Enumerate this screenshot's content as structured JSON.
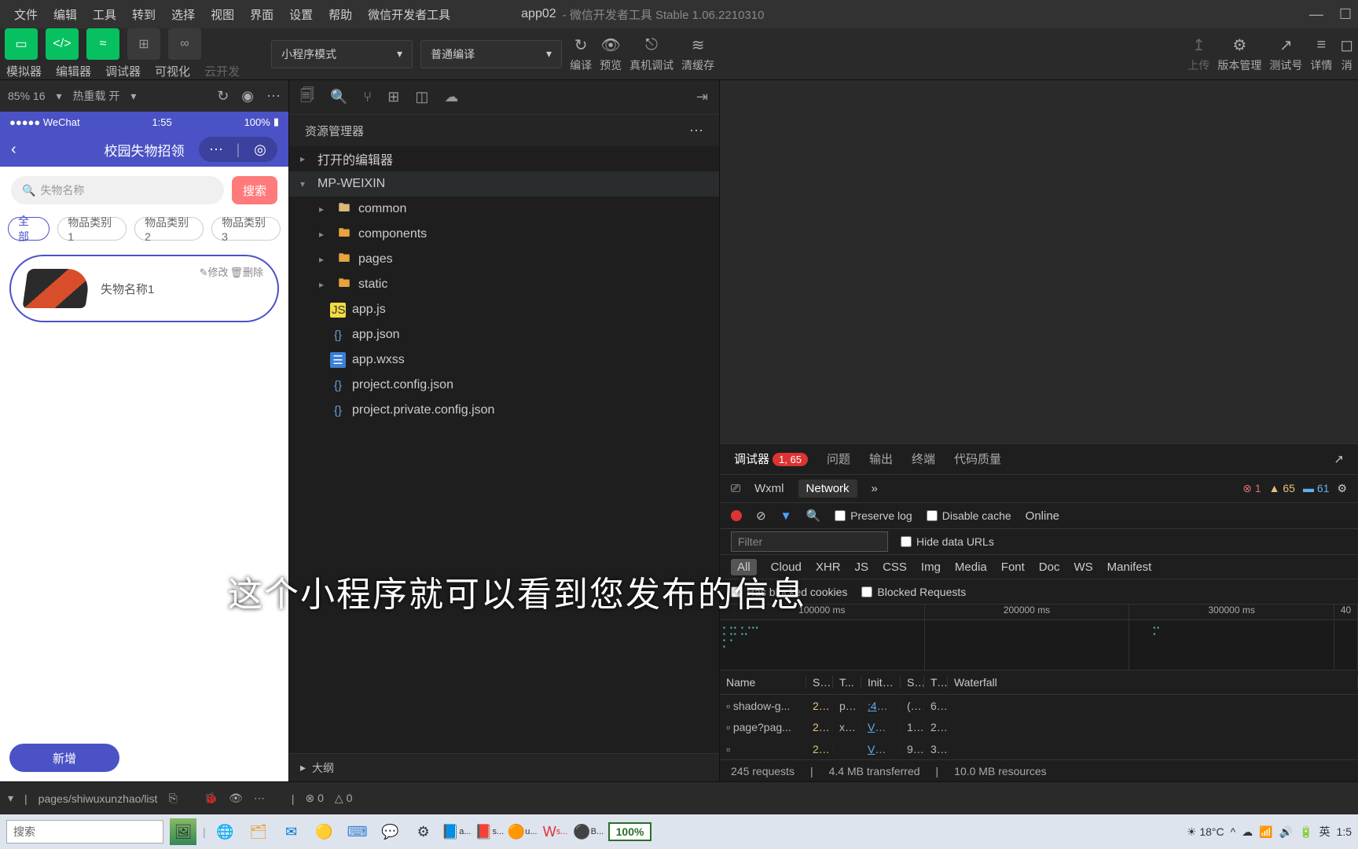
{
  "titlebar": {
    "menus": [
      "文件",
      "编辑",
      "工具",
      "转到",
      "选择",
      "视图",
      "界面",
      "设置",
      "帮助",
      "微信开发者工具"
    ],
    "app": "app02",
    "sub": " - 微信开发者工具 Stable 1.06.2210310"
  },
  "toolbar": {
    "labels": [
      "模拟器",
      "编辑器",
      "调试器",
      "可视化",
      "云开发"
    ],
    "select1": "小程序模式",
    "select2": "普通编译",
    "cols": [
      {
        "ic": "↻",
        "t": "编译"
      },
      {
        "ic": "👁",
        "t": "预览"
      },
      {
        "ic": "⎋",
        "t": "真机调试"
      },
      {
        "ic": "≋",
        "t": "清缓存"
      }
    ],
    "rcols": [
      {
        "ic": "↥",
        "t": "上传"
      },
      {
        "ic": "⚙",
        "t": "版本管理"
      },
      {
        "ic": "↗",
        "t": "测试号"
      },
      {
        "ic": "≡",
        "t": "详情"
      },
      {
        "ic": "◻",
        "t": "消"
      }
    ]
  },
  "sim": {
    "zoom": "85% 16",
    "hot": "热重载 开",
    "status": {
      "carrier": "●●●●● WeChat",
      "time": "1:55",
      "batt": "100%"
    },
    "nav": "校园失物招领",
    "search_ph": "失物名称",
    "search_btn": "搜索",
    "tabs": [
      "全部",
      "物品类别1",
      "物品类别2",
      "物品类别3"
    ],
    "card": {
      "title": "失物名称1",
      "edit": "✎修改",
      "del": "🗑删除"
    },
    "add": "新增"
  },
  "explorer": {
    "title": "资源管理器",
    "open": "打开的编辑器",
    "root": "MP-WEIXIN",
    "folders": [
      "common",
      "components",
      "pages",
      "static"
    ],
    "files": [
      "app.js",
      "app.json",
      "app.wxss",
      "project.config.json",
      "project.private.config.json"
    ],
    "outline": "大纲"
  },
  "devtools": {
    "tabs": [
      "调试器",
      "问题",
      "输出",
      "终端",
      "代码质量"
    ],
    "badge": "1, 65",
    "sub": [
      "Wxml",
      "Network"
    ],
    "err": "1",
    "warn": "65",
    "info": "61",
    "ctrl": {
      "preserve": "Preserve log",
      "disable": "Disable cache",
      "online": "Online"
    },
    "filter_ph": "Filter",
    "hide": "Hide data URLs",
    "types": [
      "All",
      "Cloud",
      "XHR",
      "JS",
      "CSS",
      "Img",
      "Media",
      "Font",
      "Doc",
      "WS",
      "Manifest"
    ],
    "blk1": "Has blocked cookies",
    "blk2": "Blocked Requests",
    "times": [
      "100000 ms",
      "200000 ms",
      "300000 ms",
      "40"
    ],
    "cols": [
      "Name",
      "S...",
      "T...",
      "Initia...",
      "S...",
      "Ti...",
      "Waterfall"
    ],
    "rows": [
      {
        "n": "shadow-g...",
        "s": "2...",
        "t": "p...",
        "i": ":422...",
        "sz": "(...",
        "ti": "6..."
      },
      {
        "n": "page?pag...",
        "s": "2...",
        "t": "xhr",
        "i": "VM2...",
        "sz": "1...",
        "ti": "2..."
      },
      {
        "n": "",
        "s": "2...",
        "t": "",
        "i": "VM2...",
        "sz": "9...",
        "ti": "3..."
      }
    ],
    "footer": {
      "req": "245 requests",
      "tx": "4.4 MB transferred",
      "res": "10.0 MB resources"
    }
  },
  "statusbot": {
    "path": "pages/shiwuxunzhao/list",
    "err": "0",
    "warn": "0"
  },
  "taskbar": {
    "search": "搜索",
    "temp": "18°C",
    "pct": "100%",
    "ime": "英",
    "time": "1:5",
    "apps": [
      "a...",
      "s...",
      "u...",
      "s...",
      "B..."
    ]
  },
  "subtitle": "这个小程序就可以看到您发布的信息"
}
